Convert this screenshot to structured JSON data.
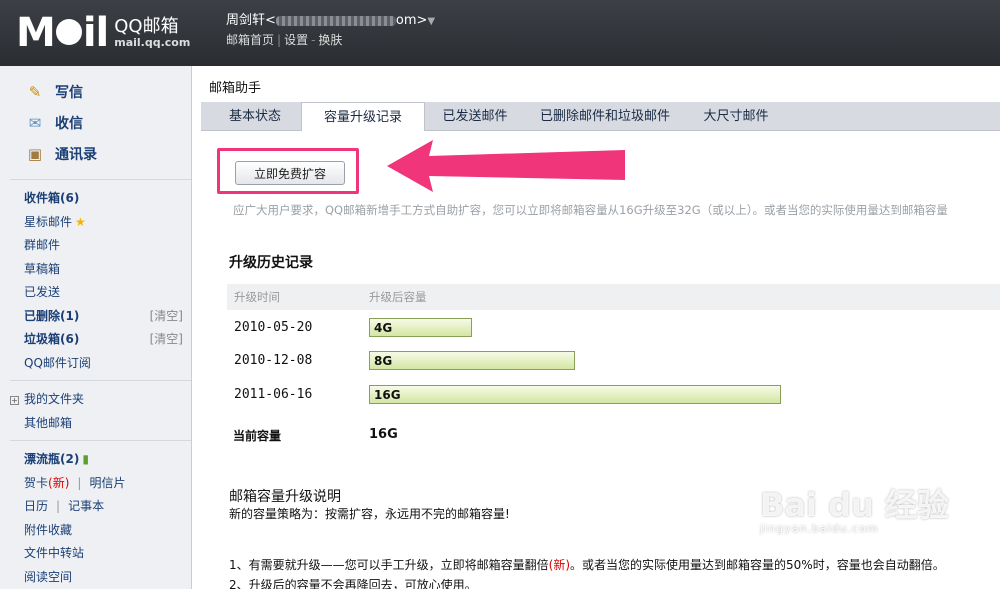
{
  "header": {
    "logo_text": "M",
    "logo_text_tail": "il",
    "logo_qq": "QQ邮箱",
    "logo_url": "mail.qq.com",
    "user_name": "周剑轩<",
    "user_email_tail": "om>",
    "links": [
      "邮箱首页",
      "设置",
      "换肤"
    ]
  },
  "sidebar": {
    "actions": [
      {
        "label": "写信",
        "icon": "write-icon"
      },
      {
        "label": "收信",
        "icon": "inbox-icon"
      },
      {
        "label": "通讯录",
        "icon": "contacts-icon"
      }
    ],
    "folders": [
      {
        "label": "收件箱(6)"
      },
      {
        "label": "星标邮件"
      },
      {
        "label": "群邮件"
      },
      {
        "label": "草稿箱"
      },
      {
        "label": "已发送"
      },
      {
        "label": "已删除(1)",
        "action": "[清空]"
      },
      {
        "label": "垃圾箱(6)",
        "action": "[清空]"
      },
      {
        "label": "QQ邮件订阅"
      }
    ],
    "my_folders": "我的文件夹",
    "other_mailbox": "其他邮箱",
    "bottle": "漂流瓶(2)",
    "card": "贺卡",
    "card_new": "(新)",
    "postcard": "明信片",
    "calendar": "日历",
    "notes": "记事本",
    "attachments": "附件收藏",
    "transfer": "文件中转站",
    "reading": "阅读空间"
  },
  "main": {
    "title": "邮箱助手",
    "tabs": [
      "基本状态",
      "容量升级记录",
      "已发送邮件",
      "已删除邮件和垃圾邮件",
      "大尺寸邮件"
    ],
    "active_tab": 1,
    "expand_button": "立即免费扩容",
    "notice": "应广大用户要求，QQ邮箱新增手工方式自助扩容，您可以立即将邮箱容量从16G升级至32G（或以上）。或者当您的实际使用量达到邮箱容量",
    "history_title": "升级历史记录",
    "col_time": "升级时间",
    "col_capacity": "升级后容量",
    "history": [
      {
        "date": "2010-05-20",
        "capacity": "4G",
        "fraction": 0.25
      },
      {
        "date": "2010-12-08",
        "capacity": "8G",
        "fraction": 0.5
      },
      {
        "date": "2011-06-16",
        "capacity": "16G",
        "fraction": 1.0
      }
    ],
    "current_label": "当前容量",
    "current_value": "16G",
    "explain_title": "邮箱容量升级说明",
    "explain_sub": "新的容量策略为：按需扩容，永远用不完的邮箱容量!",
    "explain_1a": "1、有需要就升级——您可以手工升级，立即将邮箱容量翻倍",
    "explain_1_new": "(新)",
    "explain_1b": "。或者当您的实际使用量达到邮箱容量的50%时，容量也会自动翻倍。",
    "explain_2": "2、升级后的容量不会再降回去，可放心使用。"
  },
  "watermark": {
    "main": "Bai du 经验",
    "url": "jingyan.baidu.com"
  },
  "colors": {
    "highlight": "#f0357a",
    "bar_fill": "#d4e6a3",
    "header_bg": "#2a2d31"
  }
}
